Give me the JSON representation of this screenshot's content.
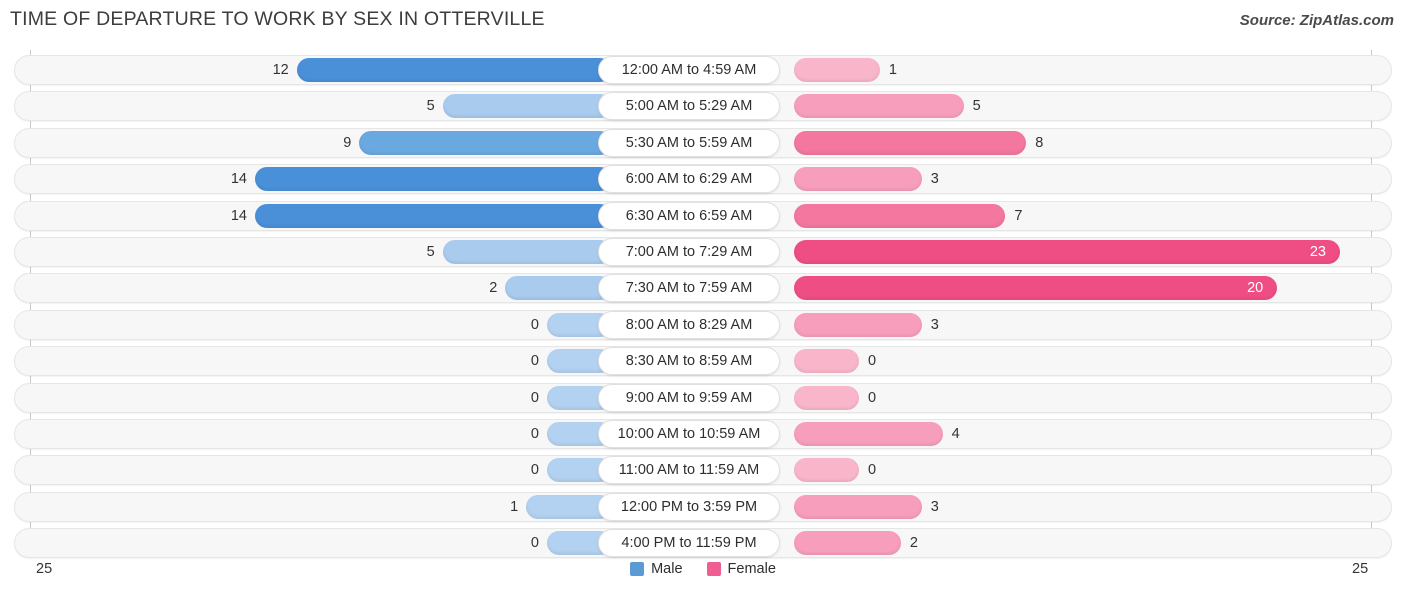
{
  "header": {
    "title": "TIME OF DEPARTURE TO WORK BY SEX IN OTTERVILLE",
    "source": "Source: ZipAtlas.com"
  },
  "axis": {
    "left_max_label": "25",
    "right_max_label": "25",
    "max": 25
  },
  "legend": {
    "items": [
      {
        "label": "Male",
        "color": "#5b9bd5"
      },
      {
        "label": "Female",
        "color": "#ef5e92"
      }
    ]
  },
  "colors": {
    "male_dark": "#4a90d9",
    "male_mid": "#6aa9e0",
    "male_light": "#a8cbee",
    "male_lightest": "#b3d1f0",
    "female_dark": "#ef4e85",
    "female_mid": "#f3779f",
    "female_light": "#f79ebc",
    "female_lightest": "#f9b6ca"
  },
  "chart_data": {
    "type": "bar",
    "orientation": "horizontal-diverging",
    "title": "TIME OF DEPARTURE TO WORK BY SEX IN OTTERVILLE",
    "xlabel": "",
    "ylabel": "",
    "xlim": [
      0,
      25
    ],
    "grid": false,
    "legend_position": "bottom-center",
    "categories": [
      "12:00 AM to 4:59 AM",
      "5:00 AM to 5:29 AM",
      "5:30 AM to 5:59 AM",
      "6:00 AM to 6:29 AM",
      "6:30 AM to 6:59 AM",
      "7:00 AM to 7:29 AM",
      "7:30 AM to 7:59 AM",
      "8:00 AM to 8:29 AM",
      "8:30 AM to 8:59 AM",
      "9:00 AM to 9:59 AM",
      "10:00 AM to 10:59 AM",
      "11:00 AM to 11:59 AM",
      "12:00 PM to 3:59 PM",
      "4:00 PM to 11:59 PM"
    ],
    "series": [
      {
        "name": "Male",
        "values": [
          12,
          5,
          9,
          14,
          14,
          5,
          2,
          0,
          0,
          0,
          0,
          0,
          1,
          0
        ]
      },
      {
        "name": "Female",
        "values": [
          1,
          5,
          8,
          3,
          7,
          23,
          20,
          3,
          0,
          0,
          4,
          0,
          3,
          2
        ]
      }
    ]
  },
  "rows": [
    {
      "category": "12:00 AM to 4:59 AM",
      "male": "12",
      "female": "1"
    },
    {
      "category": "5:00 AM to 5:29 AM",
      "male": "5",
      "female": "5"
    },
    {
      "category": "5:30 AM to 5:59 AM",
      "male": "9",
      "female": "8"
    },
    {
      "category": "6:00 AM to 6:29 AM",
      "male": "14",
      "female": "3"
    },
    {
      "category": "6:30 AM to 6:59 AM",
      "male": "14",
      "female": "7"
    },
    {
      "category": "7:00 AM to 7:29 AM",
      "male": "5",
      "female": "23"
    },
    {
      "category": "7:30 AM to 7:59 AM",
      "male": "2",
      "female": "20"
    },
    {
      "category": "8:00 AM to 8:29 AM",
      "male": "0",
      "female": "3"
    },
    {
      "category": "8:30 AM to 8:59 AM",
      "male": "0",
      "female": "0"
    },
    {
      "category": "9:00 AM to 9:59 AM",
      "male": "0",
      "female": "0"
    },
    {
      "category": "10:00 AM to 10:59 AM",
      "male": "0",
      "female": "4"
    },
    {
      "category": "11:00 AM to 11:59 AM",
      "male": "0",
      "female": "0"
    },
    {
      "category": "12:00 PM to 3:59 PM",
      "male": "1",
      "female": "3"
    },
    {
      "category": "4:00 PM to 11:59 PM",
      "male": "0",
      "female": "2"
    }
  ]
}
